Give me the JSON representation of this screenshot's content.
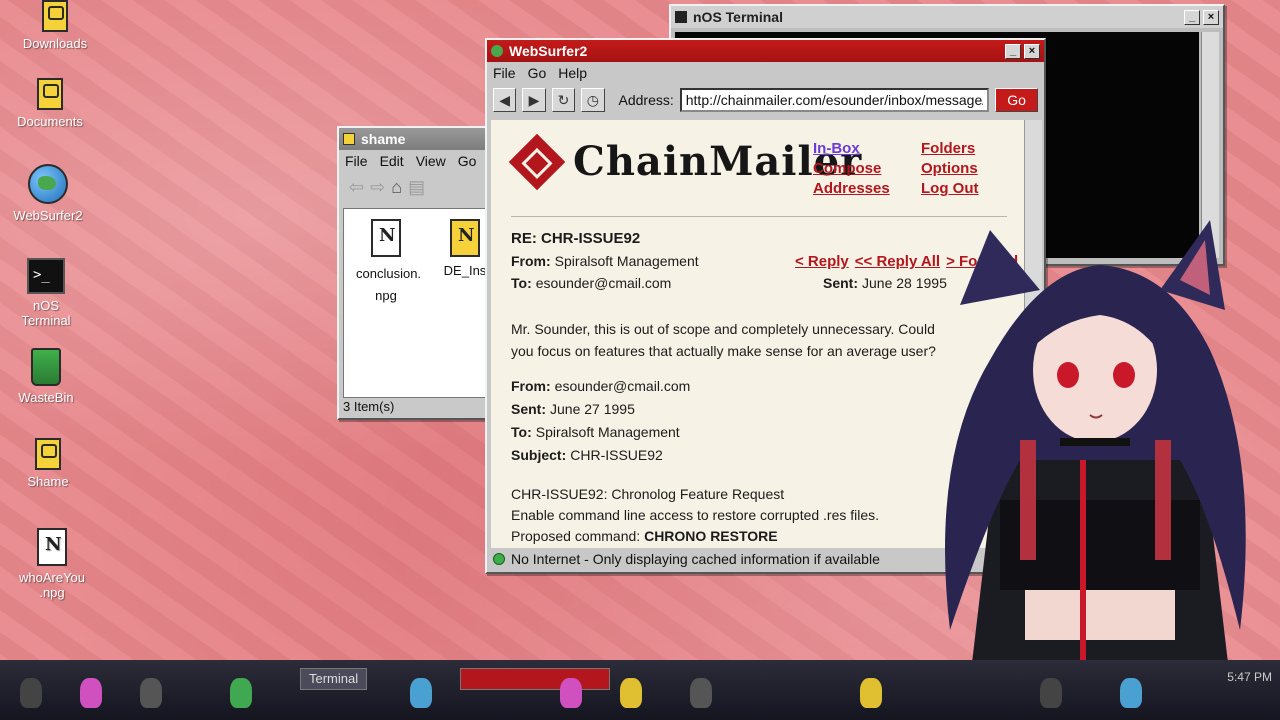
{
  "desktop": {
    "icons": [
      {
        "label": "Downloads"
      },
      {
        "label": "Documents"
      },
      {
        "label": "WebSurfer2"
      },
      {
        "label": "nOS Terminal"
      },
      {
        "label": "WasteBin"
      },
      {
        "label": "Shame"
      },
      {
        "label": "whoAreYou .npg"
      }
    ]
  },
  "terminal": {
    "title": "nOS Terminal"
  },
  "shame": {
    "title": "shame",
    "menu": [
      "File",
      "Edit",
      "View",
      "Go"
    ],
    "files": [
      {
        "name": "conclusion. npg"
      },
      {
        "name": "DE_Ins"
      }
    ],
    "status": "3 Item(s)"
  },
  "browser": {
    "title": "WebSurfer2",
    "menu": [
      "File",
      "Go",
      "Help"
    ],
    "address_label": "Address:",
    "address": "http://chainmailer.com/esounder/inbox/message/2",
    "go_label": "Go",
    "status": "No Internet - Only displaying cached information if available",
    "page": {
      "logo": "ChainMailer",
      "links": {
        "inbox": "In-Box",
        "folders": "Folders",
        "compose": "Compose",
        "options": "Options",
        "addresses": "Addresses",
        "logout": "Log Out"
      },
      "subject": "RE: CHR-ISSUE92",
      "from_label": "From:",
      "from": "Spiralsoft Management",
      "to_label": "To:",
      "to": "esounder@cmail.com",
      "reply": "< Reply",
      "reply_all": "<< Reply All",
      "forward": "> Forward",
      "sent_label": "Sent:",
      "sent": "June 28 1995",
      "body": "Mr. Sounder, this is out of scope and completely unnecessary. Could you focus on features that actually make sense for an average user?",
      "quoted": {
        "from_label": "From:",
        "from": "esounder@cmail.com",
        "sent_label": "Sent:",
        "sent": "June 27 1995",
        "to_label": "To:",
        "to": "Spiralsoft Management",
        "subject_label": "Subject:",
        "subject": "CHR-ISSUE92",
        "line1": "CHR-ISSUE92: Chronolog Feature Request",
        "line2": "Enable command line access to restore corrupted .res files.",
        "line3_label": "Proposed command:",
        "line3_value": "CHRONO RESTORE"
      }
    }
  },
  "taskbar": {
    "terminal_button": "Terminal",
    "clock": "5:47 PM"
  }
}
